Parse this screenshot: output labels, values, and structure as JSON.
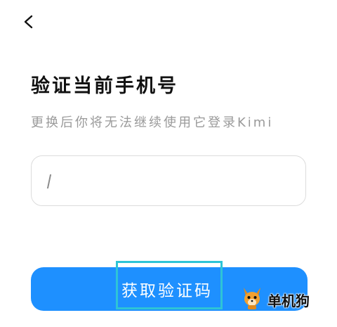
{
  "header": {
    "back_icon": "chevron-left-icon"
  },
  "main": {
    "title": "验证当前手机号",
    "subtitle": "更换后你将无法继续使用它登录Kimi",
    "phone_input": {
      "value": "",
      "placeholder": ""
    },
    "submit_label": "获取验证码"
  },
  "watermark": {
    "text": "单机狗",
    "logo_icon": "fox-mascot-icon"
  },
  "colors": {
    "accent": "#1e90ff",
    "highlight": "#2ec4d6",
    "subtitle": "#9a9a9a",
    "border": "#dcdcdc"
  }
}
